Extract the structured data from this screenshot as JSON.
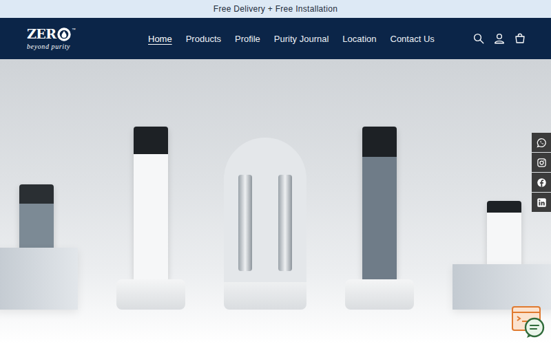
{
  "announcement": "Free Delivery + Free Installation",
  "logo": {
    "text": "ZER",
    "mark": "™",
    "tagline": "beyond purity"
  },
  "nav": [
    {
      "label": "Home",
      "selected": true
    },
    {
      "label": "Products",
      "selected": false
    },
    {
      "label": "Profile",
      "selected": false
    },
    {
      "label": "Purity Journal",
      "selected": false
    },
    {
      "label": "Location",
      "selected": false
    },
    {
      "label": "Contact Us",
      "selected": false
    }
  ]
}
